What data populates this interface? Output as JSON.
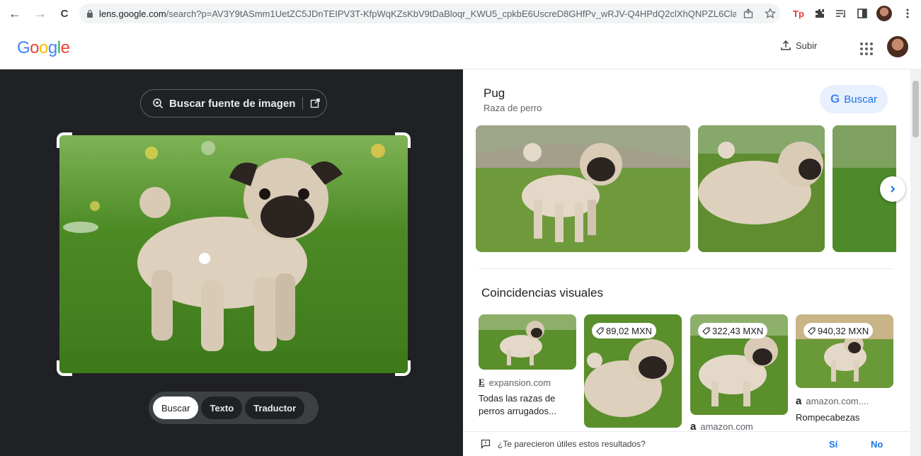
{
  "browser": {
    "url_host": "lens.google.com",
    "url_rest": "/search?p=AV3Y9tASmm1UetZC5JDnTEIPV3T-KfpWqKZsKbV9tDaBloqr_KWU5_cpkbE6UscreD8GHfPv_wRJV-Q4HPdQ2clXhQNPZL6ClacP...",
    "back_icon": "←",
    "forward_icon": "→",
    "reload_icon": "C",
    "ext_tp": "Tp"
  },
  "header": {
    "logo": [
      "G",
      "o",
      "o",
      "g",
      "l",
      "e"
    ],
    "upload_label": "Subir"
  },
  "lens": {
    "source_button": "Buscar fuente de imagen",
    "tabs": [
      "Buscar",
      "Texto",
      "Traductor"
    ]
  },
  "entity": {
    "title": "Pug",
    "subtitle": "Raza de perro",
    "search_button": "Buscar"
  },
  "visual_matches": {
    "title": "Coincidencias visuales",
    "cards": [
      {
        "price": "",
        "site_icon": "E",
        "site": "expansion.com",
        "title": "Todas las razas de perros arrugados..."
      },
      {
        "price": "89,02 MXN",
        "site_icon": "",
        "site": "",
        "title": ""
      },
      {
        "price": "322,43 MXN",
        "site_icon": "a",
        "site": "amazon.com",
        "title": ""
      },
      {
        "price": "940,32 MXN",
        "site_icon": "a",
        "site": "amazon.com....",
        "title": "Rompecabezas"
      }
    ]
  },
  "feedback": {
    "question": "¿Te parecieron útiles estos resultados?",
    "yes": "Sí",
    "no": "No"
  },
  "colors": {
    "accent": "#1a73e8",
    "dark_pane": "#202124",
    "grass": "#4f8a2a"
  }
}
